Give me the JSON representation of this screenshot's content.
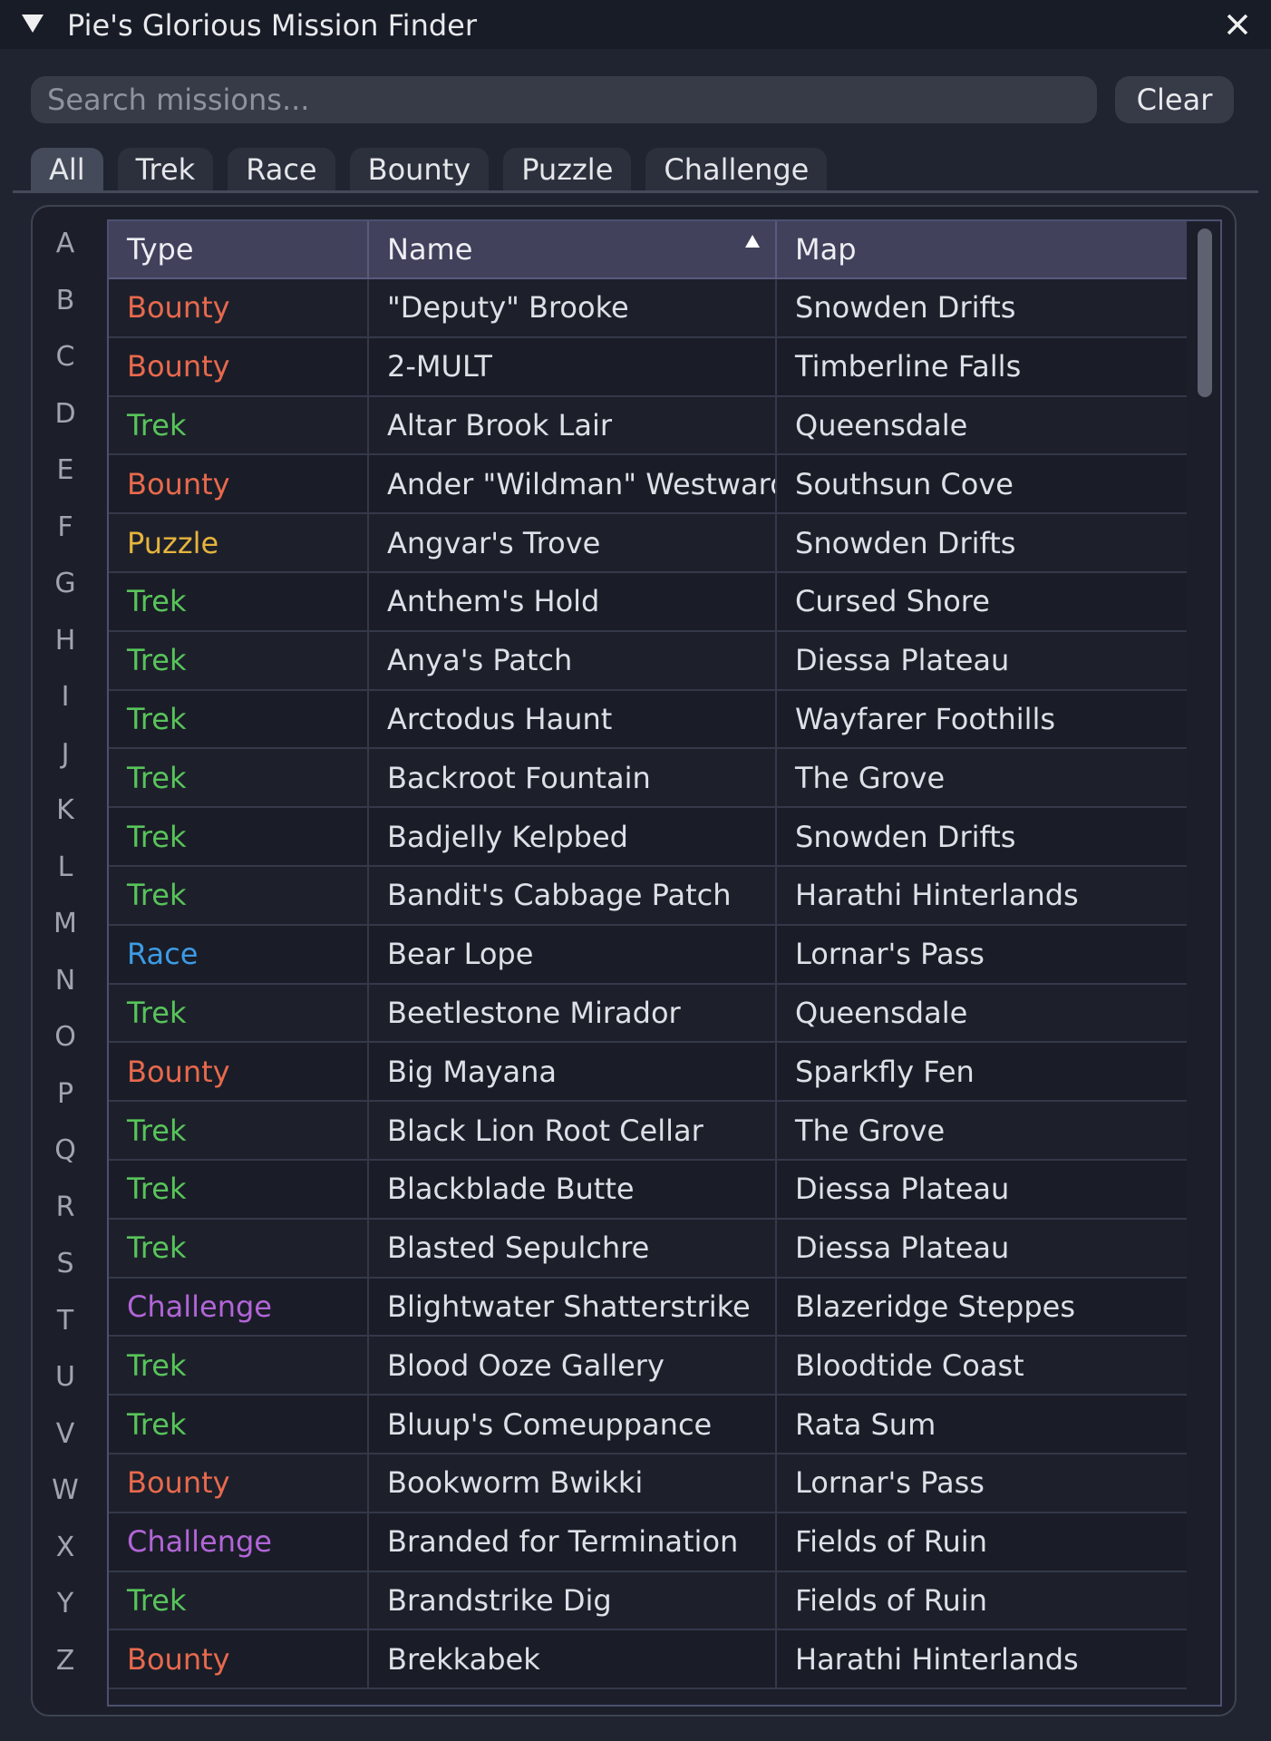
{
  "window": {
    "title": "Pie's Glorious Mission Finder"
  },
  "search": {
    "placeholder": "Search missions...",
    "value": "",
    "clear_label": "Clear"
  },
  "tabs": [
    {
      "label": "All",
      "active": true
    },
    {
      "label": "Trek",
      "active": false
    },
    {
      "label": "Race",
      "active": false
    },
    {
      "label": "Bounty",
      "active": false
    },
    {
      "label": "Puzzle",
      "active": false
    },
    {
      "label": "Challenge",
      "active": false
    }
  ],
  "alphabet": [
    "A",
    "B",
    "C",
    "D",
    "E",
    "F",
    "G",
    "H",
    "I",
    "J",
    "K",
    "L",
    "M",
    "N",
    "O",
    "P",
    "Q",
    "R",
    "S",
    "T",
    "U",
    "V",
    "W",
    "X",
    "Y",
    "Z"
  ],
  "table": {
    "columns": [
      "Type",
      "Name",
      "Map"
    ],
    "sort_column": "Name",
    "sort_direction": "ascending",
    "type_colors": {
      "Bounty": "#e8694d",
      "Trek": "#58c45a",
      "Puzzle": "#e6b43c",
      "Race": "#3d9be6",
      "Challenge": "#b265d8"
    },
    "rows": [
      {
        "type": "Bounty",
        "name": "\"Deputy\" Brooke",
        "map": "Snowden Drifts"
      },
      {
        "type": "Bounty",
        "name": "2-MULT",
        "map": "Timberline Falls"
      },
      {
        "type": "Trek",
        "name": "Altar Brook Lair",
        "map": "Queensdale"
      },
      {
        "type": "Bounty",
        "name": "Ander \"Wildman\" Westward",
        "map": "Southsun Cove"
      },
      {
        "type": "Puzzle",
        "name": "Angvar's Trove",
        "map": "Snowden Drifts"
      },
      {
        "type": "Trek",
        "name": "Anthem's Hold",
        "map": "Cursed Shore"
      },
      {
        "type": "Trek",
        "name": "Anya's Patch",
        "map": "Diessa Plateau"
      },
      {
        "type": "Trek",
        "name": "Arctodus Haunt",
        "map": "Wayfarer Foothills"
      },
      {
        "type": "Trek",
        "name": "Backroot Fountain",
        "map": "The Grove"
      },
      {
        "type": "Trek",
        "name": "Badjelly Kelpbed",
        "map": "Snowden Drifts"
      },
      {
        "type": "Trek",
        "name": "Bandit's Cabbage Patch",
        "map": "Harathi Hinterlands"
      },
      {
        "type": "Race",
        "name": "Bear Lope",
        "map": "Lornar's Pass"
      },
      {
        "type": "Trek",
        "name": "Beetlestone Mirador",
        "map": "Queensdale"
      },
      {
        "type": "Bounty",
        "name": "Big Mayana",
        "map": "Sparkfly Fen"
      },
      {
        "type": "Trek",
        "name": "Black Lion Root Cellar",
        "map": "The Grove"
      },
      {
        "type": "Trek",
        "name": "Blackblade Butte",
        "map": "Diessa Plateau"
      },
      {
        "type": "Trek",
        "name": "Blasted Sepulchre",
        "map": "Diessa Plateau"
      },
      {
        "type": "Challenge",
        "name": "Blightwater Shatterstrike",
        "map": "Blazeridge Steppes"
      },
      {
        "type": "Trek",
        "name": "Blood Ooze Gallery",
        "map": "Bloodtide Coast"
      },
      {
        "type": "Trek",
        "name": "Bluup's Comeuppance",
        "map": "Rata Sum"
      },
      {
        "type": "Bounty",
        "name": "Bookworm Bwikki",
        "map": "Lornar's Pass"
      },
      {
        "type": "Challenge",
        "name": "Branded for Termination",
        "map": "Fields of Ruin"
      },
      {
        "type": "Trek",
        "name": "Brandstrike Dig",
        "map": "Fields of Ruin"
      },
      {
        "type": "Bounty",
        "name": "Brekkabek",
        "map": "Harathi Hinterlands"
      }
    ]
  }
}
